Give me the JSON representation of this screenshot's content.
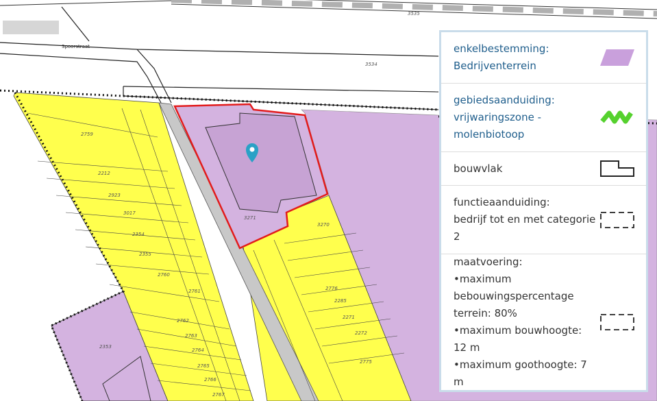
{
  "map": {
    "street_label": "Spoorstraat",
    "road_numbers": [
      "3535",
      "3534"
    ],
    "parcel_numbers": [
      "2759",
      "2212",
      "2923",
      "3017",
      "2354",
      "2355",
      "2760",
      "2761",
      "2762",
      "2763",
      "2764",
      "2765",
      "2766",
      "2767",
      "3271",
      "3270",
      "2776",
      "2285",
      "2271",
      "2272",
      "2775",
      "2353"
    ],
    "colors": {
      "bedrijventerrein": "#d4b3e0",
      "yellow_zone": "#ffff4d",
      "selected_outline": "#e21b1b",
      "marker": "#2aa1c6"
    }
  },
  "legend": {
    "items": [
      {
        "label_line1": "enkelbestemming:",
        "label_line2": "Bedrijventerrein",
        "symbol": "purple-parallelogram-icon"
      },
      {
        "label_line1": "gebiedsaanduiding:",
        "label_line2": "vrijwaringszone -",
        "label_line3": "molenbiotoop",
        "symbol": "green-zigzag-icon"
      },
      {
        "label_line1": "bouwvlak",
        "symbol": "bouwvlak-outline-icon"
      },
      {
        "label_line1": "functieaanduiding:",
        "label_line2": "bedrijf tot en met categorie",
        "label_line3": "2",
        "symbol": "dashed-rectangle-icon"
      },
      {
        "label_line1": "maatvoering:",
        "bullets": [
          "maximum",
          "bebouwingspercentage",
          "terrein: 80%",
          "maximum bouwhoogte:",
          "12 m",
          "maximum goothoogte: 7 m"
        ],
        "symbol": "dashed-rectangle-icon"
      }
    ]
  }
}
